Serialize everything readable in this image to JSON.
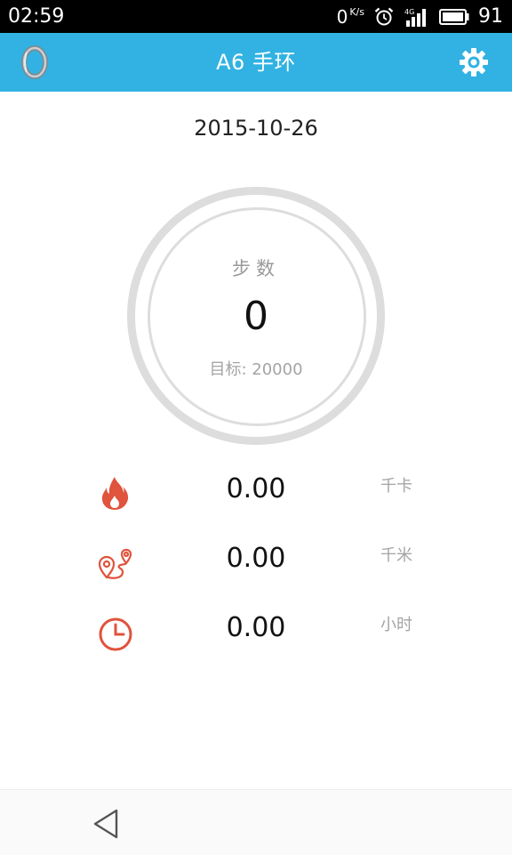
{
  "status_bar": {
    "time": "02:59",
    "net_speed_value": "0",
    "net_speed_unit": "K/s",
    "network_label": "4G",
    "battery_percent": "91"
  },
  "app_bar": {
    "title": "A6 手环",
    "left_icon": "band-icon",
    "right_icon": "settings-gear-icon"
  },
  "date": "2015-10-26",
  "steps": {
    "label": "步数",
    "value": "0",
    "goal_text": "目标: 20000"
  },
  "stats": [
    {
      "icon": "flame-icon",
      "value": "0.00",
      "unit": "千卡"
    },
    {
      "icon": "route-pin-icon",
      "value": "0.00",
      "unit": "千米"
    },
    {
      "icon": "clock-icon",
      "value": "0.00",
      "unit": "小时"
    }
  ],
  "colors": {
    "app_bar": "#31b2e2",
    "accent_red": "#e0533d",
    "ring": "#dddddd"
  },
  "nav_bar": {
    "back_icon": "back-triangle-icon"
  }
}
